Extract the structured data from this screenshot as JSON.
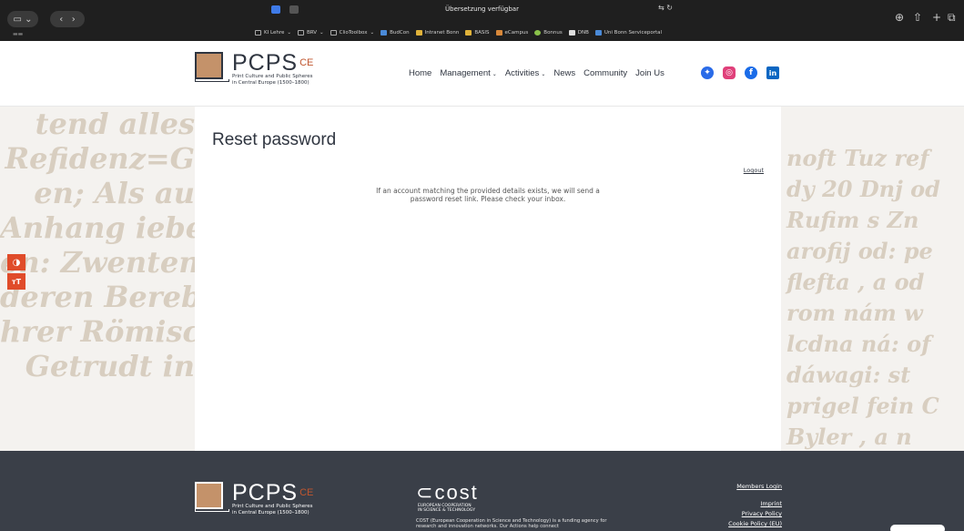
{
  "browser": {
    "tab_title": "Übersetzung verfügbar",
    "bookmarks": [
      "KI Lehre",
      "BRV",
      "ClioToolbox",
      "BudCon",
      "Intranet Bonn",
      "BASIS",
      "eCampus",
      "Bonnus",
      "DNB",
      "Uni Bonn Serviceportal"
    ]
  },
  "header": {
    "logo_main": "PCPS",
    "logo_sup": "CE",
    "logo_sub_1": "Print Culture and Public Spheres",
    "logo_sub_2": "in Central Europe (1500–1800)",
    "nav": {
      "home": "Home",
      "management": "Management",
      "activities": "Activities",
      "news": "News",
      "community": "Community",
      "join": "Join Us"
    }
  },
  "bg_left": [
    "tend alles",
    "Refidenz=G",
    "en; Als au",
    "Anhang iebe",
    "en: Zwentens",
    "deren Bereblic",
    "hrer Römisch",
    "Getrudt in"
  ],
  "bg_right": [
    "noft Tuz  ref",
    "dy 20 Dnj   od",
    "Rufim   s   Zn",
    "arofij od:   pe",
    "flefta , a   od",
    "rom nám   w",
    "lcdna ná:   of",
    "dáwagi:   st",
    "prigel fein   C",
    "Byler , a   n"
  ],
  "main": {
    "title": "Reset password",
    "logout": "Logout",
    "message": "If an account matching the provided details exists, we will send a password reset link. Please check your inbox."
  },
  "footer": {
    "cost_word": "cost",
    "cost_tag_1": "EUROPEAN COOPERATION",
    "cost_tag_2": "IN SCIENCE & TECHNOLOGY",
    "cost_desc": "COST (European Cooperation in Science and Technology) is a funding agency for research and innovation networks. Our Actions help connect",
    "members_login": "Members Login",
    "imprint": "Imprint",
    "privacy": "Privacy Policy",
    "cookie": "Cookie Policy (EU)"
  },
  "colors": {
    "accent": "#e04c2a",
    "dark": "#2f3540",
    "footer_bg": "#3a3f48"
  }
}
